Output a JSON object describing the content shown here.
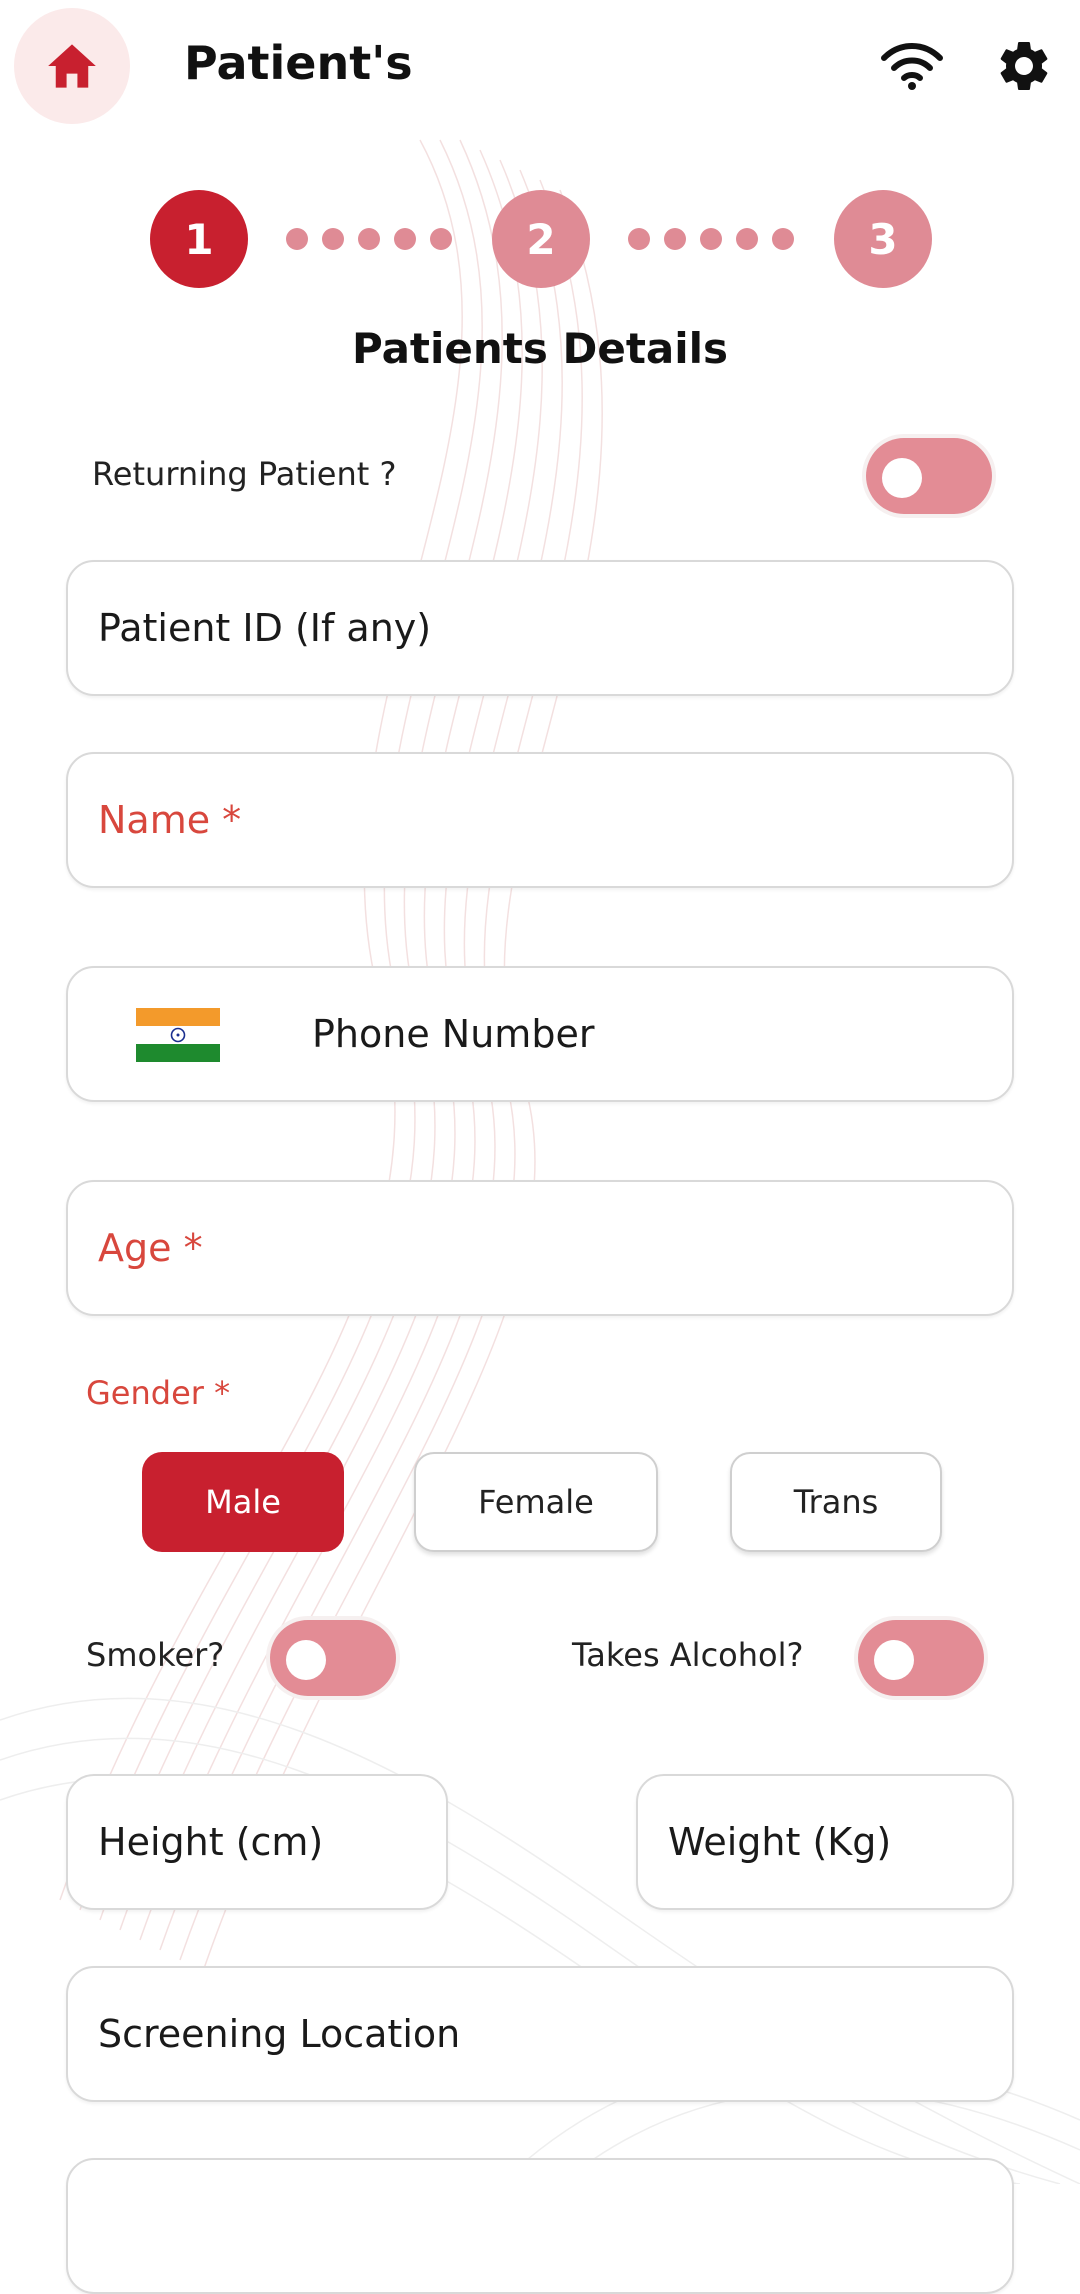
{
  "header": {
    "title": "Patient's",
    "home_icon": "home-icon",
    "wifi_icon": "wifi-icon",
    "settings_icon": "gear-icon"
  },
  "stepper": {
    "steps": [
      "1",
      "2",
      "3"
    ],
    "current": 1
  },
  "section_title": "Patients Details",
  "returning": {
    "label": "Returning Patient ?",
    "value": false
  },
  "fields": {
    "patient_id": "Patient ID (If any)",
    "name": "Name *",
    "phone": "Phone Number",
    "age": "Age *",
    "height": "Height (cm)",
    "weight": "Weight (Kg)",
    "location": "Screening Location"
  },
  "gender": {
    "label": "Gender *",
    "options": [
      "Male",
      "Female",
      "Trans"
    ],
    "selected": "Male"
  },
  "smoker": {
    "label": "Smoker?",
    "value": false
  },
  "alcohol": {
    "label": "Takes Alcohol?",
    "value": false
  },
  "colors": {
    "accent": "#c8202f",
    "accent_light": "#df8b95",
    "required": "#d8473d"
  }
}
